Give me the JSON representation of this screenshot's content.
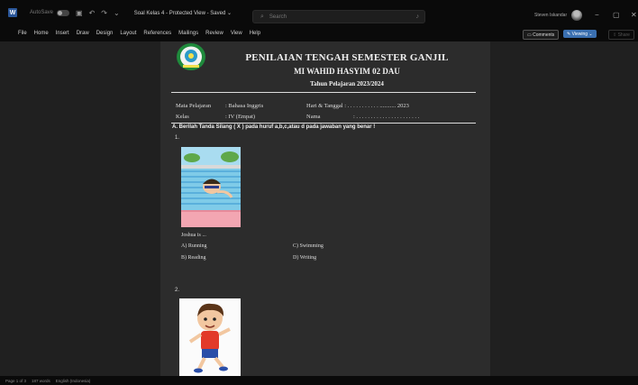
{
  "titlebar": {
    "autosave_label": "AutoSave",
    "toggle_state": "Off",
    "doc_title": "Soal Kelas 4 - Protected View - Saved ⌄",
    "search_placeholder": "Search",
    "username": "Steven Iskandar"
  },
  "ribbon": {
    "menus": [
      "File",
      "Home",
      "Insert",
      "Draw",
      "Design",
      "Layout",
      "References",
      "Mailings",
      "Review",
      "View",
      "Help"
    ],
    "comments_label": "Comments",
    "viewing_label": "Viewing",
    "share_label": "Share"
  },
  "document": {
    "school_title": "PENILAIAN TENGAH SEMESTER GANJIL",
    "school_name": "MI WAHID HASYIM 02 DAU",
    "year": "Tahun Pelajaran 2023/2024",
    "fields": {
      "subject_label": "Mata Pelajaran",
      "subject_value": ": Bahasa Inggris",
      "class_label": "Kelas",
      "class_value": ": IV (Empat)",
      "date_label": "Hari & Tanggal : . . . . . . . . . . . ........... 2023",
      "name_label": "Nama",
      "name_value": ": . . . . . . . . . . . . . . . . . . . . . ."
    },
    "instruction": "A. Berilah Tanda Silang ( X ) pada huruf a,b,c,atau d pada jawaban yang benar !",
    "questions": [
      {
        "number": "1.",
        "stem": "Joshua is ...",
        "options": [
          "A) Running",
          "B) Reading",
          "C) Swimming",
          "D) Writing"
        ]
      },
      {
        "number": "2."
      }
    ]
  },
  "statusbar": {
    "page": "Page 1 of 3",
    "words": "187 words",
    "lang": "English (Indonesia)"
  },
  "colors": {
    "accent": "#3a6fb0",
    "page_bg": "#2c2c2c",
    "canvas_bg": "#202020"
  }
}
